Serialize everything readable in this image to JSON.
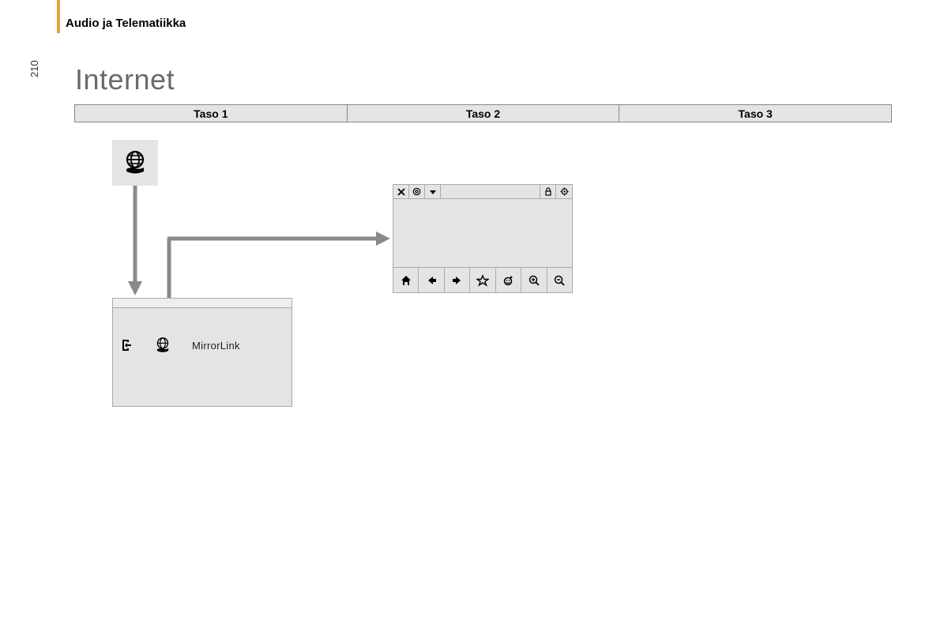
{
  "header": {
    "section": "Audio ja Telematiikka"
  },
  "page_number": "210",
  "title": "Internet",
  "levels": [
    "Taso 1",
    "Taso 2",
    "Taso 3"
  ],
  "menu_panel": {
    "icons": [
      "exit-icon",
      "globe-icon"
    ],
    "label": "MirrorLink"
  },
  "browser": {
    "top_icons": [
      "close-icon",
      "at-icon",
      "dropdown-icon",
      "lock-icon",
      "settings-icon"
    ],
    "bottom_icons": [
      "home-icon",
      "back-icon",
      "forward-icon",
      "star-icon",
      "refresh-icon",
      "zoom-in-icon",
      "zoom-out-icon"
    ]
  }
}
